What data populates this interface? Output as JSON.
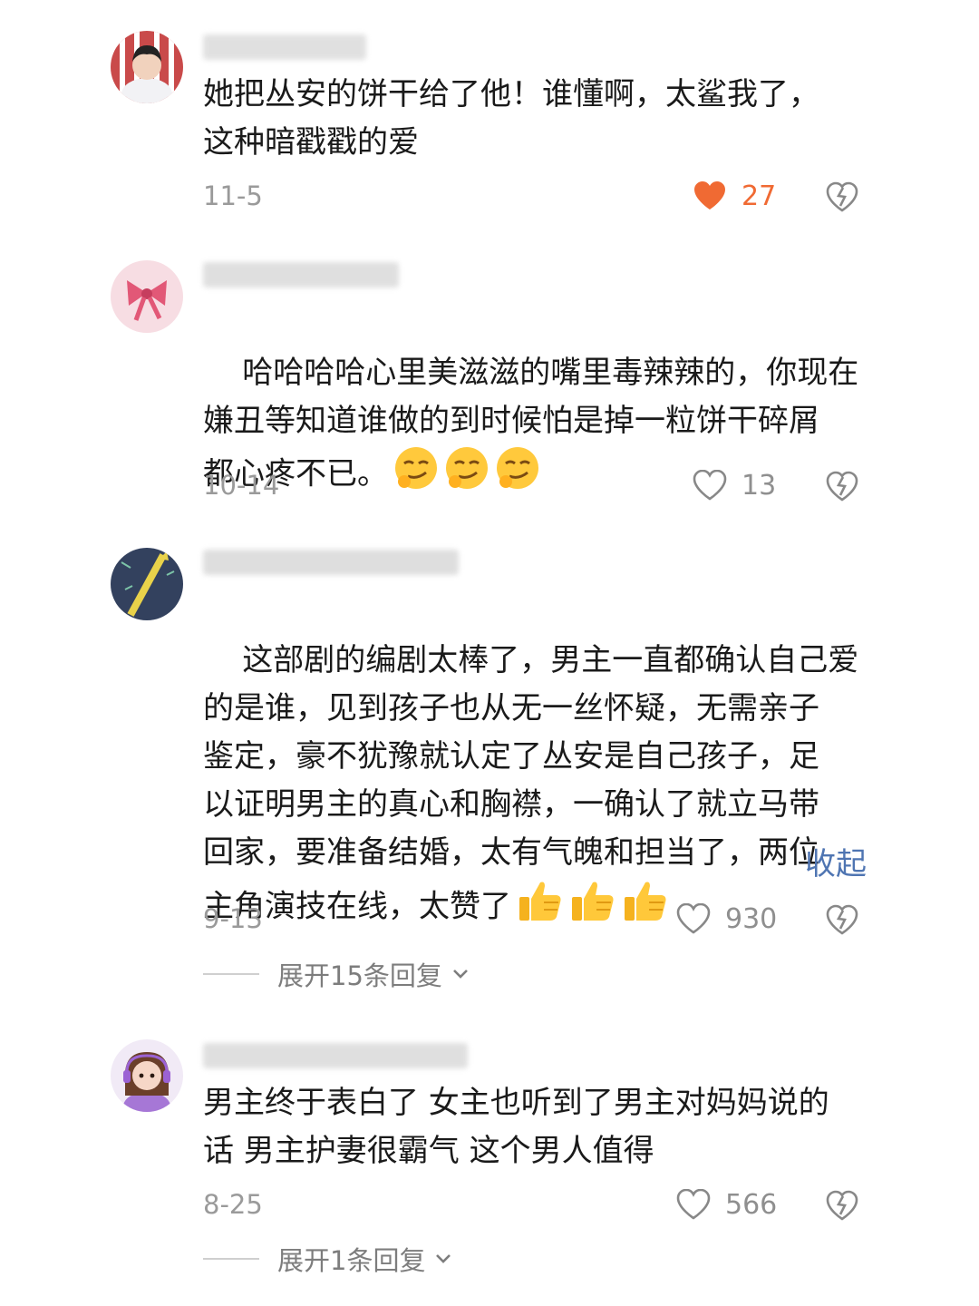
{
  "comments": [
    {
      "text": "她把丛安的饼干给了他！谁懂啊，太鲨我了，\n这种暗戳戳的爱",
      "date": "11-5",
      "likes": "27",
      "liked": true
    },
    {
      "text": "哈哈哈哈心里美滋滋的嘴里毒辣辣的，你现在\n嫌丑等知道谁做的到时候怕是掉一粒饼干碎屑\n都心疼不已。",
      "date": "10-14",
      "likes": "13",
      "liked": false
    },
    {
      "text": "这部剧的编剧太棒了，男主一直都确认自己爱\n的是谁，见到孩子也从无一丝怀疑，无需亲子\n鉴定，豪不犹豫就认定了丛安是自己孩子，足\n以证明男主的真心和胸襟，一确认了就立马带\n回家，要准备结婚，太有气魄和担当了，两位\n主角演技在线，太赞了",
      "collapse_label": "收起",
      "date": "9-13",
      "likes": "930",
      "liked": false,
      "expand_label": "展开15条回复"
    },
    {
      "text": "男主终于表白了 女主也听到了男主对妈妈说的\n话 男主护妻很霸气 这个男人值得",
      "date": "8-25",
      "likes": "566",
      "liked": false,
      "expand_label": "展开1条回复"
    }
  ],
  "colors": {
    "like_active": "#f06a33",
    "link": "#4f75b2",
    "muted": "#9a9a9a"
  },
  "icons": [
    "heart-icon",
    "dislike-icon",
    "chevron-down-icon",
    "smirk-emoji-icon",
    "thumbs-up-emoji-icon"
  ]
}
